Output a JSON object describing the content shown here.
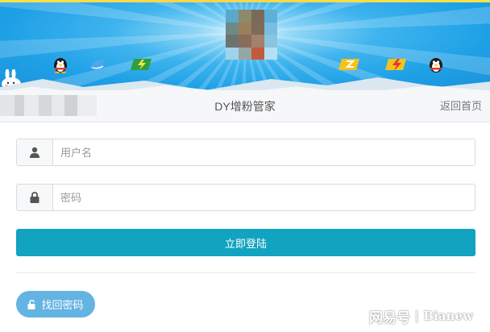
{
  "header": {
    "title": "DY增粉管家",
    "back_home": "返回首页"
  },
  "login": {
    "username_placeholder": "用户名",
    "password_placeholder": "密码",
    "submit_label": "立即登陆",
    "recover_label": "找回密码"
  },
  "icons": {
    "username": "user-icon",
    "password": "lock-icon",
    "recover": "unlock-icon"
  },
  "watermark": {
    "source": "网易号",
    "separator": "|",
    "author": "Bianew"
  },
  "colors": {
    "banner_blue": "#1ea0e6",
    "submit_teal": "#12a3c0",
    "recover_blue": "#63b3e3"
  }
}
